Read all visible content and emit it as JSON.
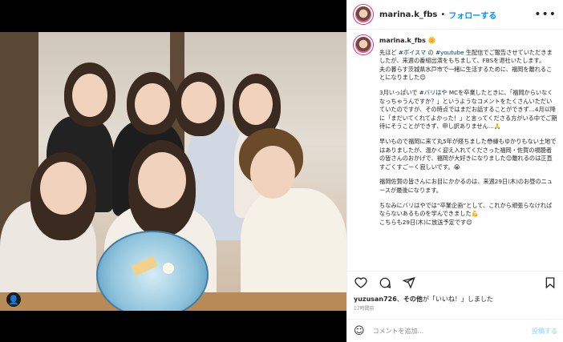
{
  "post": {
    "username": "marina.k_fbs",
    "follow_label": "フォローする",
    "more_label": "•••",
    "caption": {
      "username": "marina.k_fbs",
      "p1_a": "先ほど ",
      "p1_tag1": "#ボイスマ",
      "p1_b": " の ",
      "p1_tag2": "#youtube",
      "p1_c": " 生配信でご報告させていただきましたが、来週の番組出演をもちまして、FBSを退社いたします。\n夫の暮らす茨城県水戸市で一緒に生活するために、福岡を離れることになりました😊",
      "p2_a": "3月いっぱいで ",
      "p2_tag": "#バリはや",
      "p2_b": " MCを卒業したときに、「福岡からいなくなっちゃうんですか？」というようなコメントをたくさんいただいていたのですが、その時点ではまだお話することができず…4月以降に「まだいてくれてよかった！」と言ってくださる方がいる中でご期待にそうことができず、申し訳ありません…🙏",
      "p3": "早いもので福岡に来て丸5年が経ちました😳縁もゆかりもない土地ではありましたが、温かく迎え入れてくださった福岡・佐賀の視聴者の皆さんのおかげで、福岡が大好きになりました😊離れるのは正直すごくすごーく寂しいです。😭",
      "p4": "福岡佐賀の皆さんにお目にかかるのは、来週29日(木)のお昼のニュースが最後になります。",
      "p5": "ちなみにバリはやでは“卒業企画”として、これから頑張らなければならないあるものを学んできました💪\nこちらも29日(木)に放送予定です😊"
    },
    "likes": {
      "user": "yuzusan726",
      "text_a": "、",
      "other": "その他",
      "text_b": "が「いいね！」しました"
    },
    "date": "17時間前",
    "comment": {
      "placeholder": "コメントを追加...",
      "post_label": "投稿する"
    },
    "photo_badge": "👤"
  },
  "icons": [
    "heart-icon",
    "comment-icon",
    "share-icon",
    "bookmark-icon",
    "emoji-icon",
    "more-icon"
  ],
  "colors": {
    "follow": "#0095f6",
    "tag": "#00376b",
    "post_disabled": "#b2dffc"
  }
}
